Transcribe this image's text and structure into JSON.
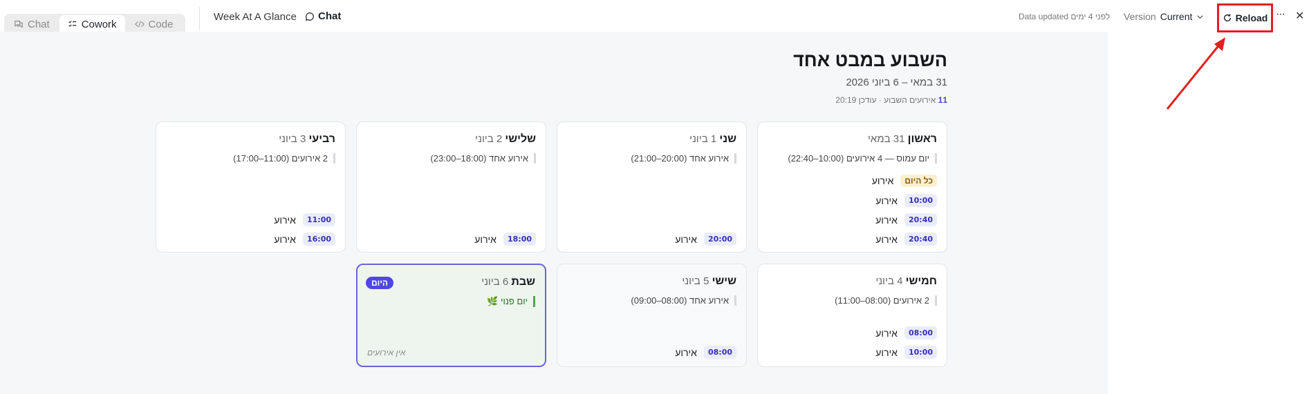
{
  "mode_tabs": [
    {
      "label": "Chat",
      "icon": "chat-bubbles-icon"
    },
    {
      "label": "Cowork",
      "icon": "checklist-icon"
    },
    {
      "label": "Code",
      "icon": "code-icon"
    }
  ],
  "toolbar": {
    "doc_title": "Week At A Glance",
    "chat_label": "Chat",
    "data_updated": "Data updated לפני 4 ימים",
    "version_label": "Version",
    "version_value": "Current",
    "reload_label": "Reload",
    "more_label": "···",
    "close_label": "✕"
  },
  "highlight": {
    "color": "#e0201f"
  },
  "page": {
    "title": "השבוע במבט אחד",
    "date_range": "31 במאי – 6 ביוני 2026",
    "event_count": "11",
    "summary_rest": " אירועים השבוע · עודכן 20:19"
  },
  "days": [
    {
      "name": "ראשון",
      "date": "31 במאי",
      "summary": "יום עמוס — 4 אירועים (10:00–22:40)",
      "allday": {
        "chip": "כל היום",
        "label": "אירוע"
      },
      "events": [
        {
          "time": "10:00",
          "label": "אירוע"
        },
        {
          "time": "20:40",
          "label": "אירוע"
        },
        {
          "time": "20:40",
          "label": "אירוע"
        }
      ]
    },
    {
      "name": "שני",
      "date": "1 ביוני",
      "summary": "אירוע אחד (20:00–21:00)",
      "events": [
        {
          "time": "20:00",
          "label": "אירוע"
        }
      ]
    },
    {
      "name": "שלישי",
      "date": "2 ביוני",
      "summary": "אירוע אחד (18:00–23:00)",
      "events": [
        {
          "time": "18:00",
          "label": "אירוע"
        }
      ]
    },
    {
      "name": "רביעי",
      "date": "3 ביוני",
      "summary": "2 אירועים (11:00–17:00)",
      "events": [
        {
          "time": "11:00",
          "label": "אירוע"
        },
        {
          "time": "16:00",
          "label": "אירוע"
        }
      ]
    },
    {
      "name": "חמישי",
      "date": "4 ביוני",
      "summary": "2 אירועים (08:00–11:00)",
      "events": [
        {
          "time": "08:00",
          "label": "אירוע"
        },
        {
          "time": "10:00",
          "label": "אירוע"
        }
      ]
    },
    {
      "name": "שישי",
      "date": "5 ביוני",
      "summary": "אירוע אחד (08:00–09:00)",
      "events": [
        {
          "time": "08:00",
          "label": "אירוע"
        }
      ]
    },
    {
      "name": "שבת",
      "date": "6 ביוני",
      "summary": "יום פנוי 🌿",
      "today_badge": "היום",
      "no_events": "אין אירועים"
    }
  ]
}
